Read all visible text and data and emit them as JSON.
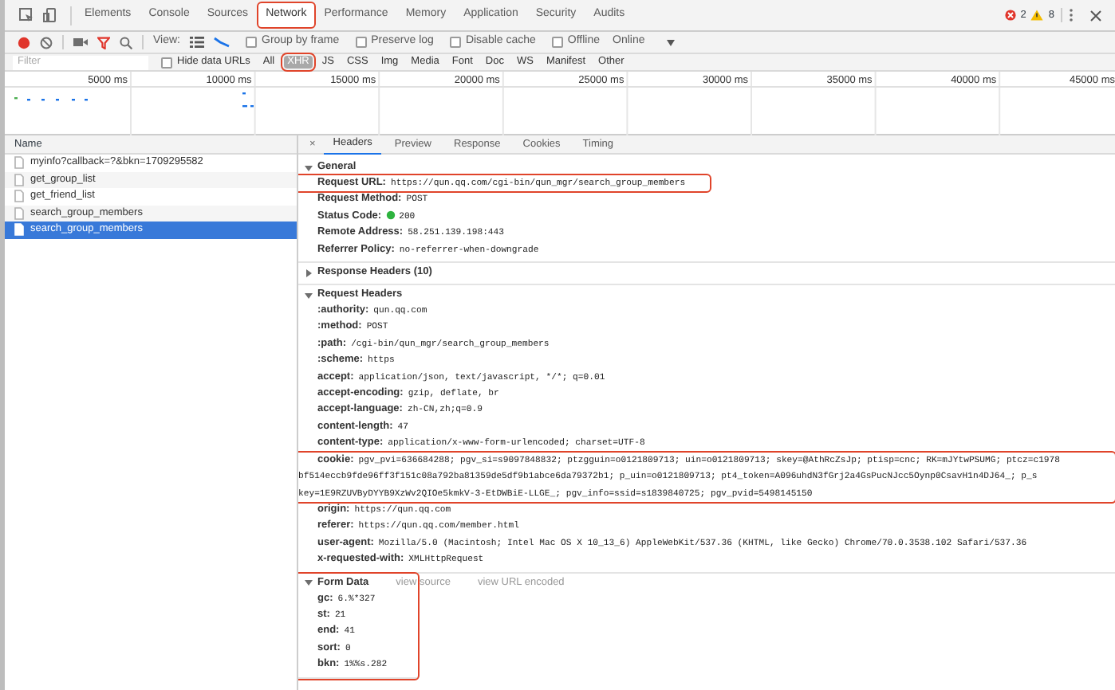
{
  "panel_tabs": [
    {
      "label": "Elements",
      "selected": false,
      "highlighted": false
    },
    {
      "label": "Console",
      "selected": false,
      "highlighted": false
    },
    {
      "label": "Sources",
      "selected": false,
      "highlighted": false
    },
    {
      "label": "Network",
      "selected": true,
      "highlighted": true
    },
    {
      "label": "Performance",
      "selected": false,
      "highlighted": false
    },
    {
      "label": "Memory",
      "selected": false,
      "highlighted": false
    },
    {
      "label": "Application",
      "selected": false,
      "highlighted": false
    },
    {
      "label": "Security",
      "selected": false,
      "highlighted": false
    },
    {
      "label": "Audits",
      "selected": false,
      "highlighted": false
    }
  ],
  "counters": {
    "errors": "2",
    "warnings": "8"
  },
  "toolbar": {
    "recording": true,
    "filter_active": true,
    "view_label": "View:",
    "checkboxes": [
      {
        "label": "Group by frame",
        "checked": false
      },
      {
        "label": "Preserve log",
        "checked": false
      },
      {
        "label": "Disable cache",
        "checked": false
      },
      {
        "label": "Offline",
        "checked": false
      }
    ],
    "throttling": "Online"
  },
  "filter_bar": {
    "placeholder": "Filter",
    "hide_data_urls": {
      "label": "Hide data URLs",
      "checked": false
    },
    "types": [
      {
        "label": "All",
        "selected": false,
        "highlighted": false
      },
      {
        "label": "XHR",
        "selected": true,
        "highlighted": true
      },
      {
        "label": "JS",
        "selected": false,
        "highlighted": false
      },
      {
        "label": "CSS",
        "selected": false,
        "highlighted": false
      },
      {
        "label": "Img",
        "selected": false,
        "highlighted": false
      },
      {
        "label": "Media",
        "selected": false,
        "highlighted": false
      },
      {
        "label": "Font",
        "selected": false,
        "highlighted": false
      },
      {
        "label": "Doc",
        "selected": false,
        "highlighted": false
      },
      {
        "label": "WS",
        "selected": false,
        "highlighted": false
      },
      {
        "label": "Manifest",
        "selected": false,
        "highlighted": false
      },
      {
        "label": "Other",
        "selected": false,
        "highlighted": false
      }
    ]
  },
  "timeline": {
    "ticks": [
      "5000 ms",
      "10000 ms",
      "15000 ms",
      "20000 ms",
      "25000 ms",
      "30000 ms",
      "35000 ms",
      "40000 ms",
      "45000 ms"
    ]
  },
  "requests": {
    "column": "Name",
    "items": [
      {
        "name": "myinfo?callback=?&bkn=1709295582",
        "selected": false
      },
      {
        "name": "get_group_list",
        "selected": false
      },
      {
        "name": "get_friend_list",
        "selected": false
      },
      {
        "name": "search_group_members",
        "selected": false
      },
      {
        "name": "search_group_members",
        "selected": true
      }
    ]
  },
  "details": {
    "close": "×",
    "tabs": [
      {
        "label": "Headers",
        "selected": true
      },
      {
        "label": "Preview",
        "selected": false
      },
      {
        "label": "Response",
        "selected": false
      },
      {
        "label": "Cookies",
        "selected": false
      },
      {
        "label": "Timing",
        "selected": false
      }
    ],
    "sections": [
      {
        "title": "General",
        "expanded": true,
        "highlighted": false,
        "fields": [
          {
            "name": "Request URL:",
            "value_lines": [
              "https://qun.qq.com/cgi-bin/qun_mgr/search_group_members"
            ],
            "highlighted": true
          },
          {
            "name": "Request Method:",
            "value_lines": [
              "POST"
            ],
            "highlighted": false
          },
          {
            "name": "Status Code:",
            "value_lines": [
              "200"
            ],
            "color": "#2eb33f",
            "highlighted": false
          },
          {
            "name": "Remote Address:",
            "value_lines": [
              "58.251.139.198:443"
            ],
            "highlighted": false
          },
          {
            "name": "Referrer Policy:",
            "value_lines": [
              "no-referrer-when-downgrade"
            ],
            "highlighted": false
          }
        ]
      },
      {
        "title": "Response Headers (10)",
        "expanded": false,
        "highlighted": false
      },
      {
        "title": "Request Headers",
        "expanded": true,
        "highlighted": false,
        "fields": [
          {
            "name": ":authority:",
            "value_lines": [
              "qun.qq.com"
            ],
            "highlighted": false
          },
          {
            "name": ":method:",
            "value_lines": [
              "POST"
            ],
            "highlighted": false
          },
          {
            "name": ":path:",
            "value_lines": [
              "/cgi-bin/qun_mgr/search_group_members"
            ],
            "highlighted": false
          },
          {
            "name": ":scheme:",
            "value_lines": [
              "https"
            ],
            "highlighted": false
          },
          {
            "name": "accept:",
            "value_lines": [
              "application/json, text/javascript, */*; q=0.01"
            ],
            "highlighted": false
          },
          {
            "name": "accept-encoding:",
            "value_lines": [
              "gzip, deflate, br"
            ],
            "highlighted": false
          },
          {
            "name": "accept-language:",
            "value_lines": [
              "zh-CN,zh;q=0.9"
            ],
            "highlighted": false
          },
          {
            "name": "content-length:",
            "value_lines": [
              "47"
            ],
            "highlighted": false
          },
          {
            "name": "content-type:",
            "value_lines": [
              "application/x-www-form-urlencoded; charset=UTF-8"
            ],
            "highlighted": false
          },
          {
            "name": "cookie:",
            "value_lines": [
              "pgv_pvi=636684288; pgv_si=s9097848832; ptzgguin=o0121809713; uin=o0121809713; skey=@AthRcZsJp; ptisp=cnc; RK=mJYtwPSUMG; ptcz=c1978",
              "bf514eccb9fde96ff3f151c08a792ba81359de5df9b1abce6da79372b1; p_uin=o0121809713; pt4_token=A096uhdN3fGrj2a4GsPucNJcc5Oynp0CsavH1n4DJ64_; p_s",
              "key=1E9RZUVByDYYB9XzWv2QIOe5kmkV-3-EtDWBiE-LLGE_; pgv_info=ssid=s1839840725; pgv_pvid=5498145150"
            ],
            "highlighted": true
          },
          {
            "name": "origin:",
            "value_lines": [
              "https://qun.qq.com"
            ],
            "highlighted": false
          },
          {
            "name": "referer:",
            "value_lines": [
              "https://qun.qq.com/member.html"
            ],
            "highlighted": false
          },
          {
            "name": "user-agent:",
            "value_lines": [
              "Mozilla/5.0 (Macintosh; Intel Mac OS X 10_13_6) AppleWebKit/537.36 (KHTML, like Gecko) Chrome/70.0.3538.102 Safari/537.36"
            ],
            "highlighted": false
          },
          {
            "name": "x-requested-with:",
            "value_lines": [
              "XMLHttpRequest"
            ],
            "highlighted": false
          }
        ]
      },
      {
        "title": "Form Data",
        "expanded": true,
        "highlighted": true,
        "links": [
          "view source",
          "view URL encoded"
        ],
        "fields": [
          {
            "name": "gc:",
            "value_lines": [
              "6.%*327"
            ],
            "highlighted": false
          },
          {
            "name": "st:",
            "value_lines": [
              "21"
            ],
            "highlighted": false
          },
          {
            "name": "end:",
            "value_lines": [
              "41"
            ],
            "highlighted": false
          },
          {
            "name": "sort:",
            "value_lines": [
              "0"
            ],
            "highlighted": false
          },
          {
            "name": "bkn:",
            "value_lines": [
              "1%%s.282"
            ],
            "highlighted": false
          }
        ]
      }
    ]
  }
}
